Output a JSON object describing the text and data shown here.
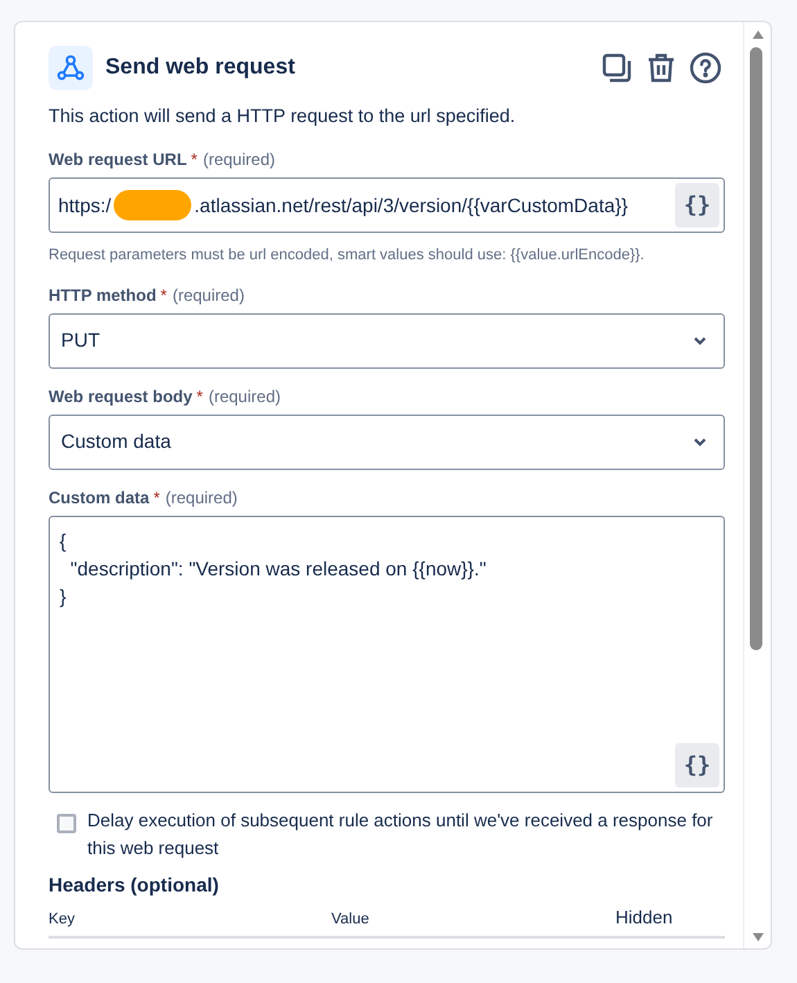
{
  "header": {
    "title": "Send web request"
  },
  "description": "This action will send a HTTP request to the url specified.",
  "url_field": {
    "label": "Web request URL",
    "required_mark": "*",
    "required_note": "(required)",
    "value_start": "https:/",
    "redacted": true,
    "value_end": ".atlassian.net/rest/api/3/version/{{varCustomData}}",
    "smart_value_button": "{}"
  },
  "url_help": "Request parameters must be url encoded, smart values should use: {{value.urlEncode}}.",
  "method_field": {
    "label": "HTTP method",
    "required_mark": "*",
    "required_note": "(required)",
    "value": "PUT"
  },
  "body_field": {
    "label": "Web request body",
    "required_mark": "*",
    "required_note": "(required)",
    "value": "Custom data"
  },
  "custom_data": {
    "label": "Custom data",
    "required_mark": "*",
    "required_note": "(required)",
    "lines": [
      "{",
      "  \"description\": \"Version was released on {{now}}.\"",
      "}"
    ],
    "smart_value_button": "{}"
  },
  "delay_option": {
    "label": "Delay execution of subsequent rule actions until we've received a response for this web request",
    "checked": false
  },
  "headers": {
    "title": "Headers (optional)",
    "columns": [
      "Key",
      "Value",
      "Hidden"
    ]
  }
}
